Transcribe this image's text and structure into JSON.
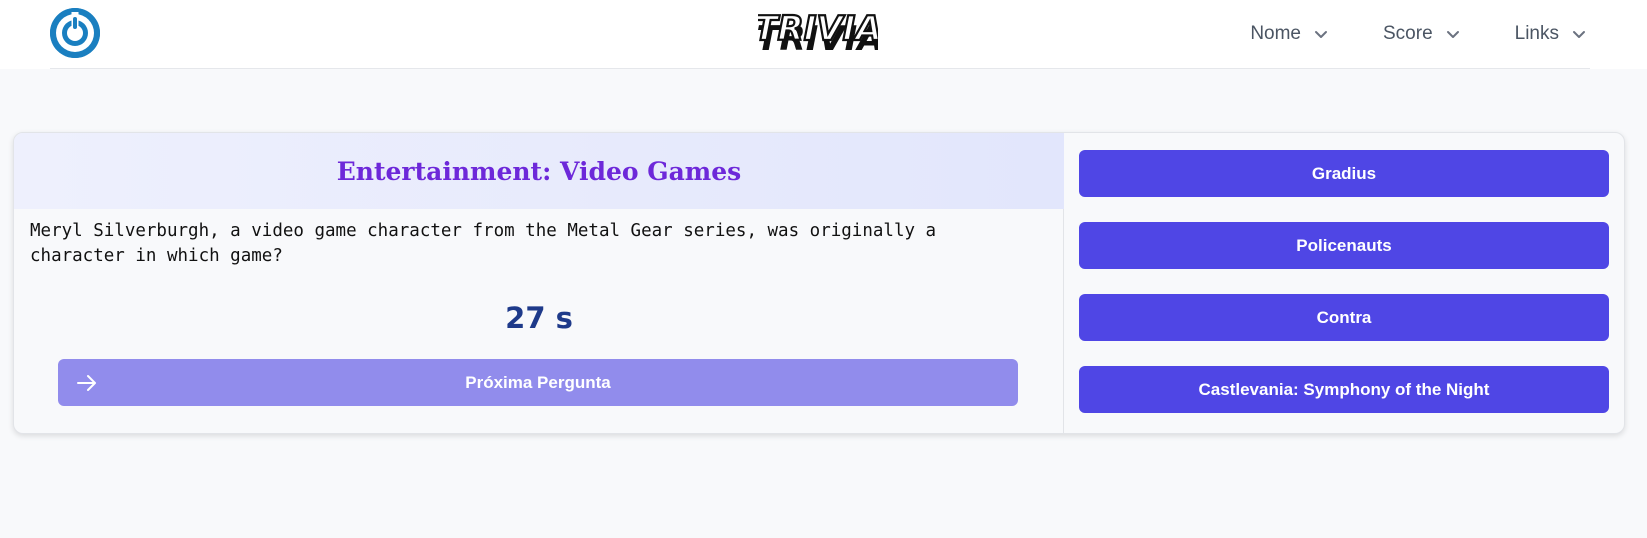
{
  "header": {
    "logo_icon": "power-icon",
    "brand": "TRIVIA",
    "nav": [
      {
        "label": "Nome",
        "icon": "chevron-down-icon"
      },
      {
        "label": "Score",
        "icon": "chevron-down-icon"
      },
      {
        "label": "Links",
        "icon": "chevron-down-icon"
      }
    ]
  },
  "question": {
    "category": "Entertainment: Video Games",
    "text": "Meryl Silverburgh, a video game character from the Metal Gear series, was originally a character in which game?",
    "timer": "27 s",
    "next_label": "Próxima Pergunta",
    "next_icon": "arrow-right-icon"
  },
  "answers": [
    "Gradius",
    "Policenauts",
    "Contra",
    "Castlevania: Symphony of the Night"
  ],
  "colors": {
    "accent": "#4f46e5",
    "accent_muted": "#918cec",
    "category": "#6d28d9",
    "timer": "#1e3a8a",
    "logo": "#1a7fc0"
  }
}
